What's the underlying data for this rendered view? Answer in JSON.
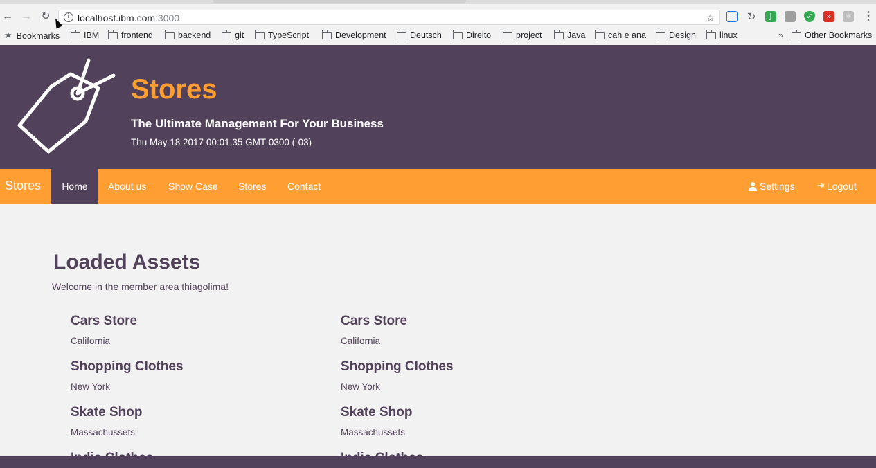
{
  "browser": {
    "url_host": "localhost.ibm.com",
    "url_port": ":3000",
    "bookmarks_label": "Bookmarks",
    "bookmark_folders": [
      "IBM",
      "frontend",
      "backend",
      "git",
      "TypeScript",
      "Development",
      "Deutsch",
      "Direito",
      "project",
      "Java",
      "cah e ana",
      "Design",
      "linux"
    ],
    "overflow_label": "»",
    "other_bookmarks": "Other Bookmarks"
  },
  "header": {
    "title": "Stores",
    "subtitle": "The Ultimate Management For Your Business",
    "datetime": "Thu May 18 2017 00:01:35 GMT-0300 (-03)"
  },
  "navbar": {
    "brand": "Stores",
    "items": [
      "Home",
      "About us",
      "Show Case",
      "Stores",
      "Contact"
    ],
    "active_item": "Home",
    "settings": "Settings",
    "logout": "Logout"
  },
  "main": {
    "title": "Loaded Assets",
    "welcome": "Welcome in the member area thiagolima!",
    "stores_left": [
      {
        "name": "Cars Store",
        "location": "California"
      },
      {
        "name": "Shopping Clothes",
        "location": "New York"
      },
      {
        "name": "Skate Shop",
        "location": "Massachussets"
      },
      {
        "name": "Indie Clothes",
        "location": ""
      }
    ],
    "stores_right": [
      {
        "name": "Cars Store",
        "location": "California"
      },
      {
        "name": "Shopping Clothes",
        "location": "New York"
      },
      {
        "name": "Skate Shop",
        "location": "Massachussets"
      },
      {
        "name": "Indie Clothes",
        "location": ""
      }
    ]
  },
  "colors": {
    "primary": "#52415a",
    "accent": "#ff9f33",
    "background": "#f2f2f2"
  },
  "icons": [
    "back-icon",
    "forward-icon",
    "reload-icon",
    "info-icon",
    "star-icon",
    "folder-icon",
    "tag-icon",
    "user-icon",
    "login-icon"
  ]
}
